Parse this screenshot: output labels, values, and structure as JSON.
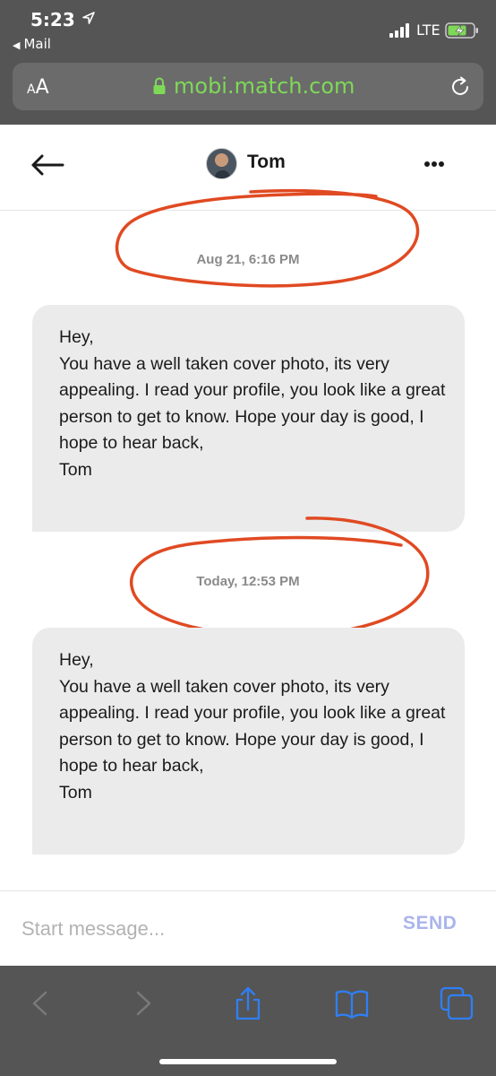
{
  "status_bar": {
    "time": "5:23",
    "back_app": "Mail",
    "network": "LTE"
  },
  "browser": {
    "text_size_label_small": "A",
    "text_size_label_big": "A",
    "url": "mobi.match.com",
    "accent_color": "#7ed957"
  },
  "conversation": {
    "contact_name": "Tom",
    "messages": [
      {
        "timestamp": "Aug 21, 6:16 PM",
        "text": "Hey,\nYou have a well taken cover photo, its very appealing. I read your profile, you look like a great person to get to know. Hope your day is good,  I hope to hear back,\nTom"
      },
      {
        "timestamp": "Today, 12:53 PM",
        "text": "Hey,\nYou have a well taken cover photo, its very appealing. I read your profile, you look like a great person to get to know. Hope your day is good,  I hope to hear back,\nTom"
      }
    ],
    "annotation_color": "#e04a22"
  },
  "composer": {
    "placeholder": "Start message...",
    "send_label": "SEND",
    "send_color": "#aab4ec"
  },
  "toolbar": {
    "icons": [
      "back-icon",
      "forward-icon",
      "share-icon",
      "bookmarks-icon",
      "tabs-icon"
    ],
    "icon_color": "#2f7ff7"
  }
}
